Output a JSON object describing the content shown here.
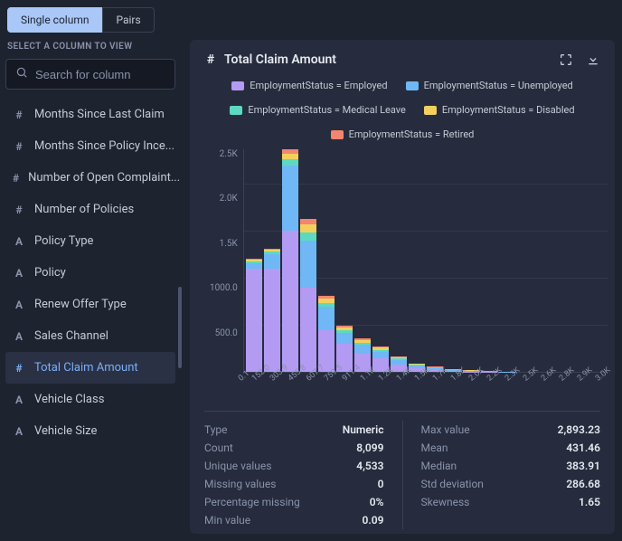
{
  "tabs": {
    "single": "Single column",
    "pairs": "Pairs"
  },
  "sidebar": {
    "title": "SELECT A COLUMN TO VIEW",
    "search_placeholder": "Search for column",
    "items": [
      {
        "icon": "#",
        "label": "Months Since Last Claim"
      },
      {
        "icon": "#",
        "label": "Months Since Policy Ince..."
      },
      {
        "icon": "#",
        "label": "Number of Open Complaint..."
      },
      {
        "icon": "#",
        "label": "Number of Policies"
      },
      {
        "icon": "A",
        "label": "Policy Type"
      },
      {
        "icon": "A",
        "label": "Policy"
      },
      {
        "icon": "A",
        "label": "Renew Offer Type"
      },
      {
        "icon": "A",
        "label": "Sales Channel"
      },
      {
        "icon": "#",
        "label": "Total Claim Amount",
        "active": true
      },
      {
        "icon": "A",
        "label": "Vehicle Class"
      },
      {
        "icon": "A",
        "label": "Vehicle Size"
      }
    ]
  },
  "panel": {
    "title_icon": "#",
    "title": "Total Claim Amount"
  },
  "chart_data": {
    "type": "bar",
    "stacked": true,
    "title": "Total Claim Amount",
    "xlabel": "",
    "ylabel": "",
    "ylim": [
      0,
      2500
    ],
    "y_ticks": [
      "2.5K",
      "2.0K",
      "1.5K",
      "1000.0",
      "500.0",
      ""
    ],
    "categories": [
      "0.1",
      "152.0",
      "303.9",
      "455.8",
      "607.7",
      "759.5",
      "911.4",
      "1.1K",
      "1.2K",
      "1.4K",
      "1.5K",
      "1.7K",
      "1.8K",
      "2.0K",
      "2.2K",
      "2.3K",
      "2.5K",
      "2.6K",
      "2.8K",
      "2.9K",
      "3.0K"
    ],
    "legend": [
      {
        "name": "EmploymentStatus = Employed",
        "color": "#b39bf3"
      },
      {
        "name": "EmploymentStatus = Unemployed",
        "color": "#6fb8f5"
      },
      {
        "name": "EmploymentStatus = Medical Leave",
        "color": "#5dd9c1"
      },
      {
        "name": "EmploymentStatus = Disabled",
        "color": "#f2d05e"
      },
      {
        "name": "EmploymentStatus = Retired",
        "color": "#f4866f"
      }
    ],
    "series": [
      {
        "name": "Employed",
        "color": "#b39bf3",
        "values": [
          1100,
          1100,
          1500,
          900,
          450,
          300,
          200,
          150,
          80,
          40,
          20,
          10,
          5,
          5,
          0,
          0,
          0,
          0,
          0,
          0
        ]
      },
      {
        "name": "Unemployed",
        "color": "#6fb8f5",
        "values": [
          60,
          150,
          700,
          500,
          250,
          120,
          90,
          70,
          50,
          30,
          20,
          15,
          10,
          5,
          5,
          0,
          0,
          0,
          0,
          0
        ]
      },
      {
        "name": "Medical Leave",
        "color": "#5dd9c1",
        "values": [
          20,
          30,
          60,
          90,
          40,
          30,
          25,
          20,
          15,
          10,
          8,
          5,
          4,
          3,
          0,
          0,
          0,
          0,
          0,
          0
        ]
      },
      {
        "name": "Disabled",
        "color": "#f2d05e",
        "values": [
          15,
          20,
          60,
          80,
          40,
          30,
          25,
          20,
          12,
          8,
          6,
          4,
          3,
          2,
          0,
          0,
          0,
          0,
          0,
          0
        ]
      },
      {
        "name": "Retired",
        "color": "#f4866f",
        "values": [
          10,
          15,
          50,
          60,
          30,
          20,
          18,
          14,
          10,
          8,
          5,
          3,
          2,
          2,
          0,
          0,
          0,
          0,
          0,
          0
        ]
      }
    ]
  },
  "stats": {
    "left": [
      {
        "label": "Type",
        "value": "Numeric"
      },
      {
        "label": "Count",
        "value": "8,099"
      },
      {
        "label": "Unique values",
        "value": "4,533"
      },
      {
        "label": "Missing values",
        "value": "0"
      },
      {
        "label": "Percentage missing",
        "value": "0%"
      },
      {
        "label": "Min value",
        "value": "0.09"
      }
    ],
    "right": [
      {
        "label": "Max value",
        "value": "2,893.23"
      },
      {
        "label": "Mean",
        "value": "431.46"
      },
      {
        "label": "Median",
        "value": "383.91"
      },
      {
        "label": "Std deviation",
        "value": "286.68"
      },
      {
        "label": "Skewness",
        "value": "1.65"
      }
    ]
  }
}
